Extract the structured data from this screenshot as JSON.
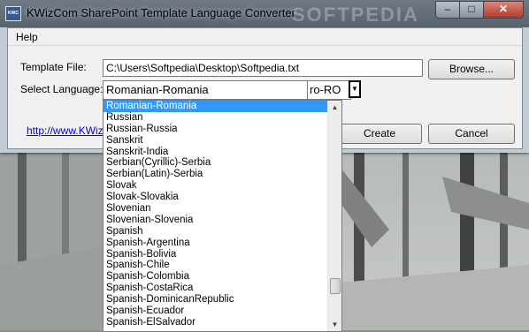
{
  "window": {
    "title": "KWizCom SharePoint Template Language Converter",
    "icon_label": "KWC",
    "watermark": "SOFTPEDIA",
    "minimize_glyph": "–",
    "maximize_glyph": "□",
    "close_glyph": "✕"
  },
  "menu": {
    "help": "Help"
  },
  "form": {
    "template_label": "Template File:",
    "template_value": "C:\\Users\\Softpedia\\Desktop\\Softpedia.txt",
    "browse_label": "Browse...",
    "language_label": "Select Language:",
    "language_value": "Romanian-Romania",
    "language_code": "ro-RO",
    "dropdown_glyph": "▼",
    "link_text": "http://www.KWiz",
    "create_label": "Create",
    "cancel_label": "Cancel"
  },
  "dropdown": {
    "items": [
      "Romanian-Romania",
      "Russian",
      "Russian-Russia",
      "Sanskrit",
      "Sanskrit-India",
      "Serbian(Cyrillic)-Serbia",
      "Serbian(Latin)-Serbia",
      "Slovak",
      "Slovak-Slovakia",
      "Slovenian",
      "Slovenian-Slovenia",
      "Spanish",
      "Spanish-Argentina",
      "Spanish-Bolivia",
      "Spanish-Chile",
      "Spanish-Colombia",
      "Spanish-CostaRica",
      "Spanish-DominicanRepublic",
      "Spanish-Ecuador",
      "Spanish-ElSalvador"
    ],
    "selected_index": 0,
    "scroll_position": 0.88,
    "scroll_up_glyph": "▲",
    "scroll_down_glyph": "▼"
  },
  "colors": {
    "selection": "#3399ff",
    "link": "#0000ee"
  }
}
